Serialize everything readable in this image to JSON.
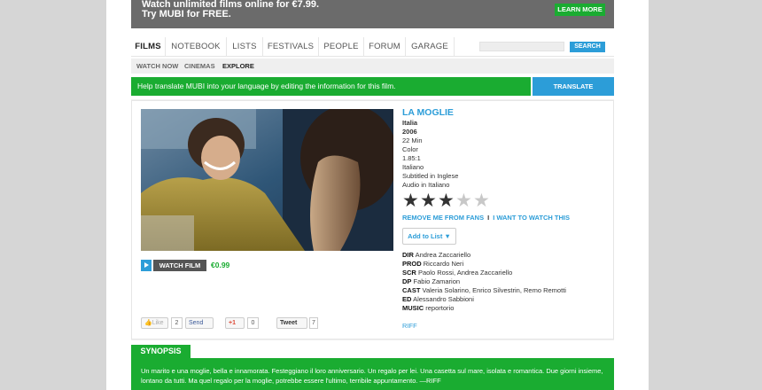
{
  "promo": {
    "line1": "Watch unlimited films online for €7.99.",
    "line2": "Try MUBI for FREE.",
    "learn_more": "LEARN MORE"
  },
  "nav": {
    "tabs": [
      {
        "label": "FILMS",
        "active": true
      },
      {
        "label": "NOTEBOOK",
        "active": false
      },
      {
        "label": "LISTS",
        "active": false
      },
      {
        "label": "FESTIVALS",
        "active": false
      },
      {
        "label": "PEOPLE",
        "active": false
      },
      {
        "label": "FORUM",
        "active": false
      },
      {
        "label": "GARAGE",
        "active": false
      }
    ],
    "search_value": "",
    "search_button": "SEARCH"
  },
  "subnav": {
    "items": [
      {
        "label": "WATCH NOW",
        "active": false
      },
      {
        "label": "CINEMAS",
        "active": false
      },
      {
        "label": "EXPLORE",
        "active": true
      }
    ]
  },
  "banner": {
    "text": "Help translate MUBI into your language by editing the information for this film.",
    "button": "TRANSLATE"
  },
  "film": {
    "title": "LA MOGLIE",
    "country": "Italia",
    "year": "2006",
    "duration": "22 Min",
    "color": "Color",
    "aspect": "1.85:1",
    "language": "Italiano",
    "subtitles": "Subtitled in Inglese",
    "audio": "Audio in Italiano",
    "rating": 3,
    "rating_max": 5,
    "remove_fans": "REMOVE ME FROM FANS",
    "link_separator": "I",
    "want_watch": "I WANT TO WATCH THIS",
    "add_to_list": "Add to List ▼",
    "credits": [
      {
        "role": "DIR",
        "names": "Andrea Zaccariello"
      },
      {
        "role": "PROD",
        "names": "Riccardo Neri"
      },
      {
        "role": "SCR",
        "names": "Paolo Rossi, Andrea Zaccariello"
      },
      {
        "role": "DP",
        "names": "Fabio Zamarion"
      },
      {
        "role": "CAST",
        "names": "Valeria Solarino, Enrico Silvestrin, Remo Remotti"
      },
      {
        "role": "ED",
        "names": "Alessandro Sabbioni"
      },
      {
        "role": "MUSIC",
        "names": "reportorio"
      }
    ],
    "source": "RIFF"
  },
  "watch": {
    "label": "WATCH FILM",
    "price": "€0.99"
  },
  "social": {
    "like": "Like",
    "like_count": "2",
    "send": "Send",
    "gplus": "+1",
    "gplus_count": "0",
    "tweet": "Tweet",
    "tweet_count": "7"
  },
  "synopsis": {
    "heading": "SYNOPSIS",
    "text": "Un marito e una moglie, bella e innamorata. Festeggiano il loro anniversario. Un regalo per lei. Una casetta sul mare, isolata e romantica. Due giorni insieme, lontano da tutti. Ma quel regalo per la moglie, potrebbe essere l'ultimo, terribile appuntamento. —RIFF"
  }
}
